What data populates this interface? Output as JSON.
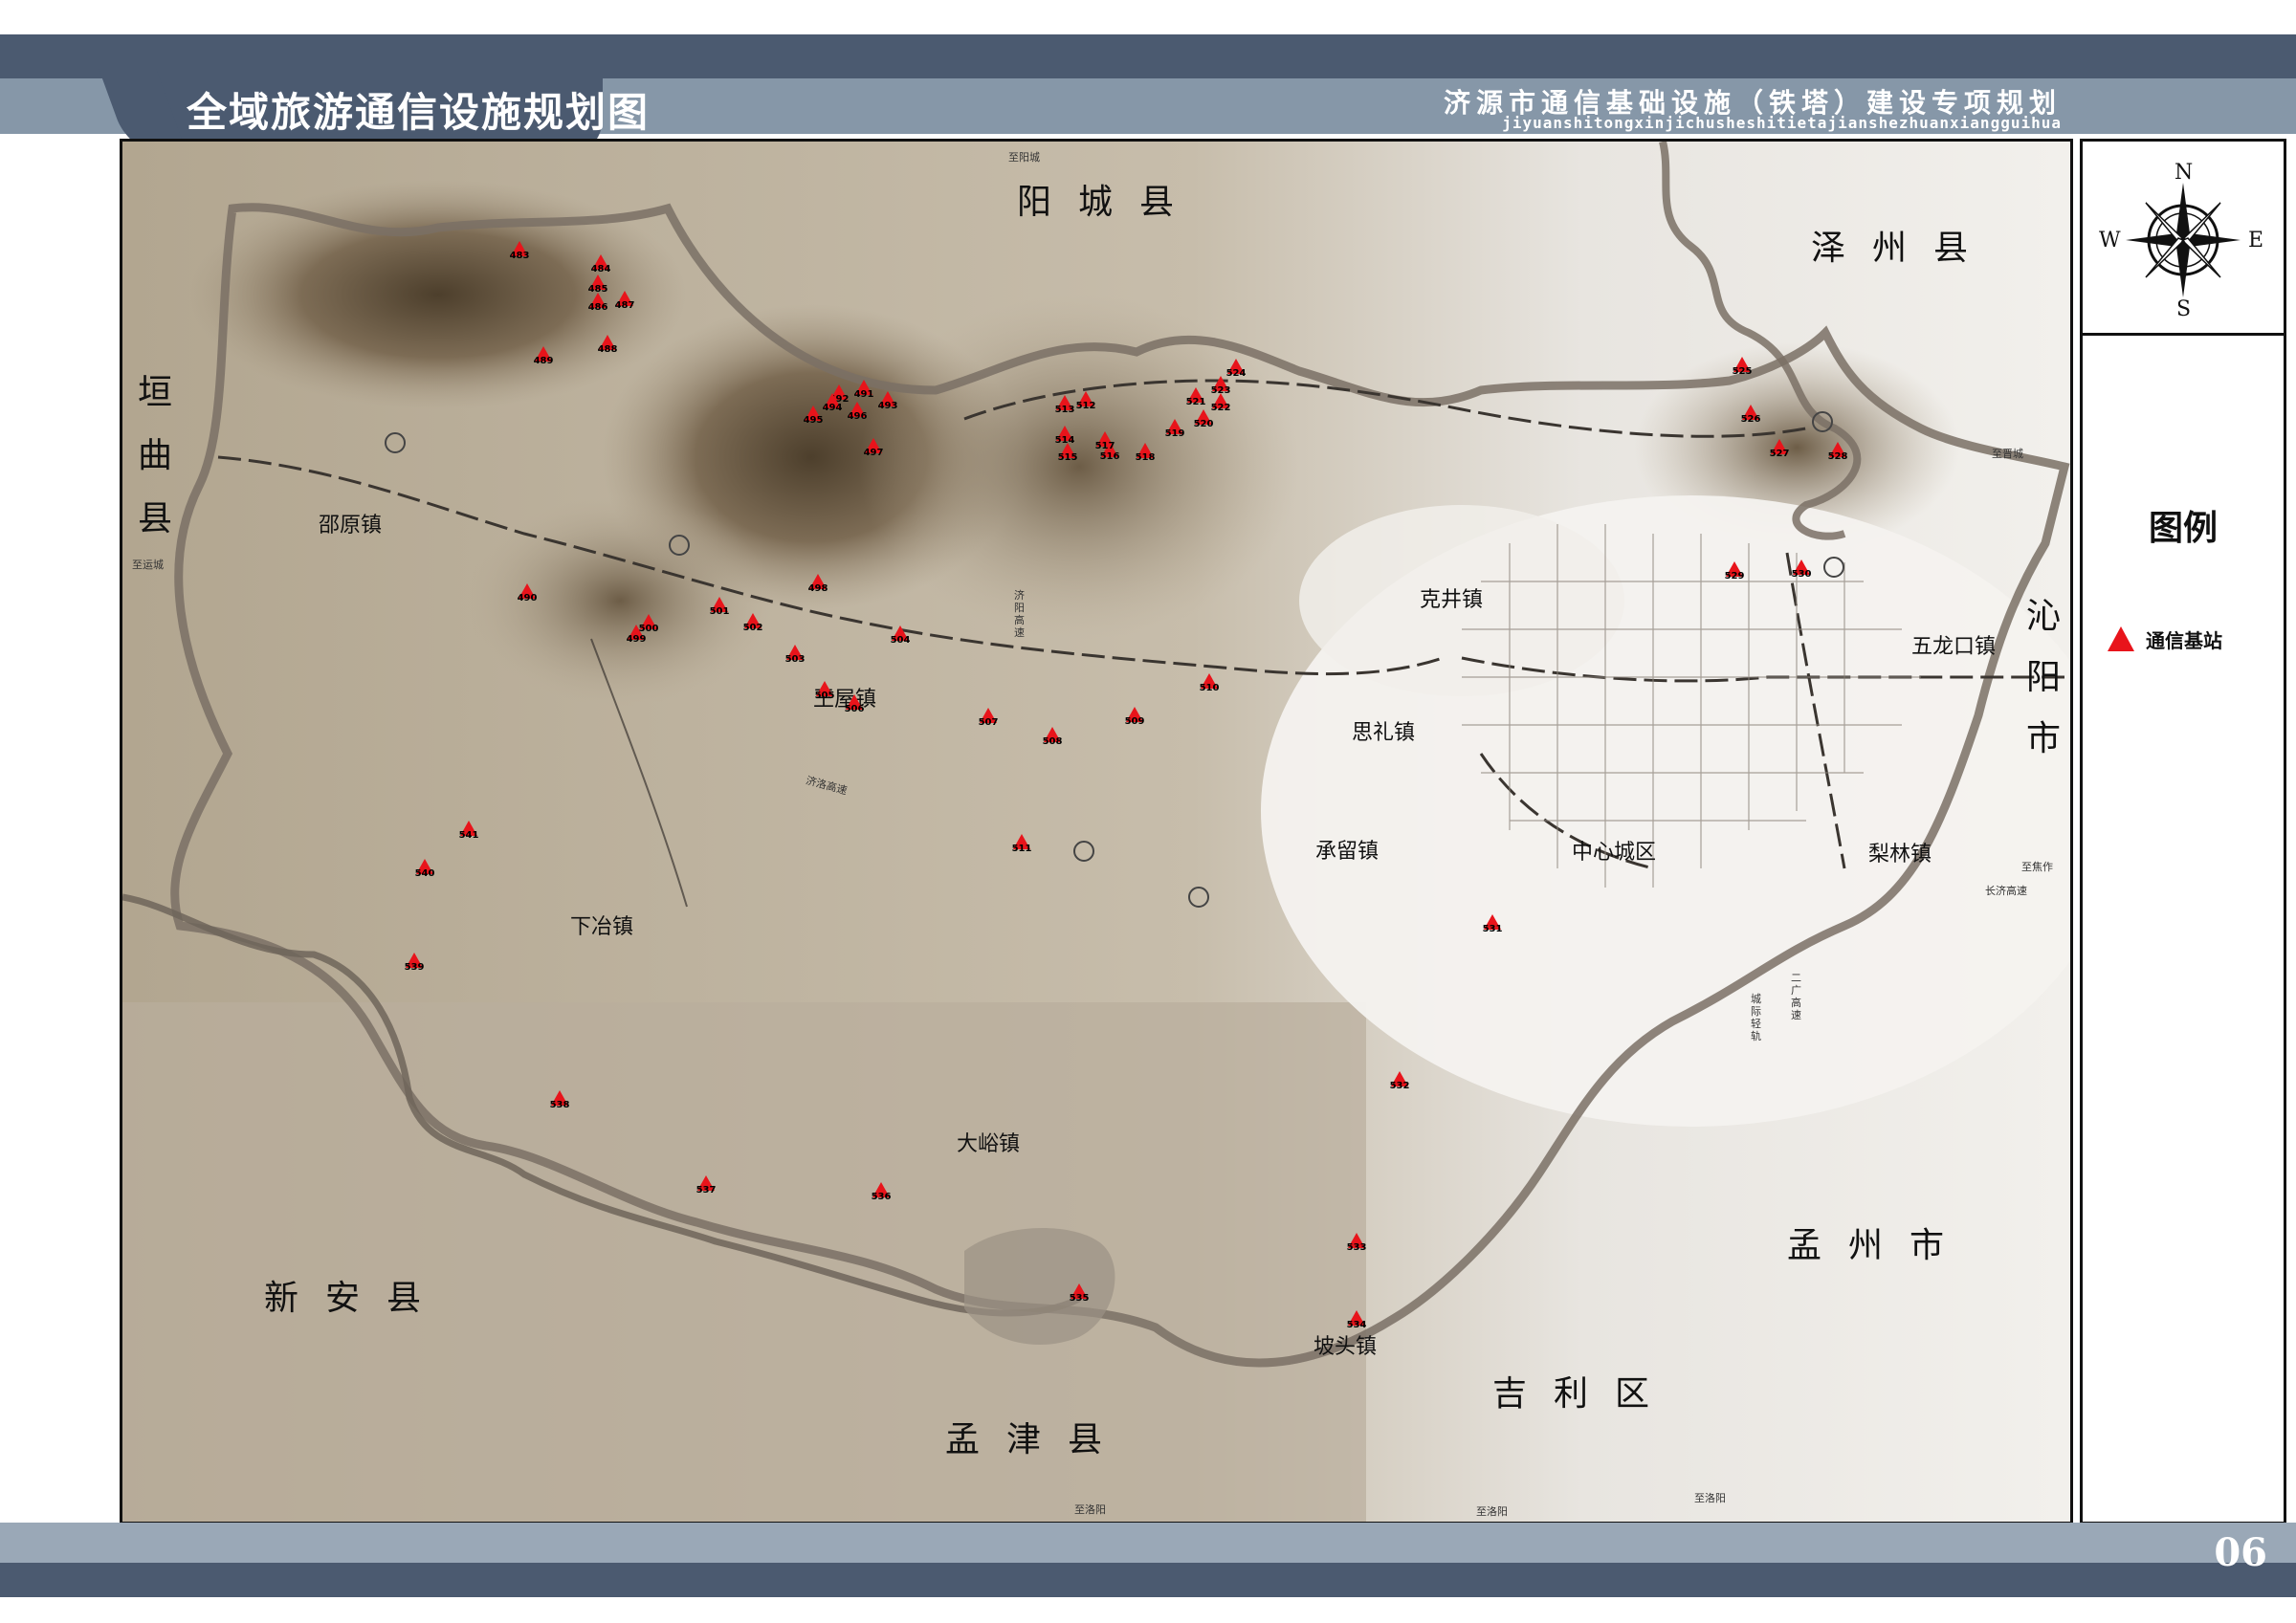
{
  "header": {
    "main_title": "全域旅游通信设施规划图",
    "project_title": "济源市通信基础设施（铁塔）建设专项规划",
    "pinyin": "jiyuanshitongxinjichusheshitietajianshezhuanxiangguihua"
  },
  "footer": {
    "page_number": "06"
  },
  "compass": {
    "n": "N",
    "s": "S",
    "e": "E",
    "w": "W"
  },
  "legend": {
    "title": "图例",
    "items": [
      {
        "label": "通信基站",
        "symbol": "red-triangle",
        "color": "#e8141b"
      }
    ]
  },
  "map": {
    "neighbors": {
      "yangcheng": "阳城县",
      "zezhou": "泽州县",
      "yuanqu": "垣曲县",
      "qinyang": "沁阳市",
      "xinan": "新安县",
      "mengjin": "孟津县",
      "jili": "吉利区",
      "mengzhou": "孟州市"
    },
    "towns": {
      "shaoyuan": "邵原镇",
      "wangwu": "王屋镇",
      "xiaye": "下冶镇",
      "dayu": "大峪镇",
      "potou": "坡头镇",
      "kejing": "克井镇",
      "sili": "思礼镇",
      "chengliu": "承留镇",
      "center": "中心城区",
      "wulongkou": "五龙口镇",
      "lilin": "梨林镇"
    },
    "road_labels": {
      "to_yangcheng": "至阳城",
      "to_yuncheng": "至运城",
      "to_jincheng": "至晋城",
      "to_jiaozuo": "至焦作",
      "changji": "长济高速",
      "jiyang": "济阳高速",
      "jiluo": "济洛高速",
      "to_luoyang_1": "至洛阳",
      "to_luoyang_2": "至洛阳",
      "to_luoyang_3": "至洛阳",
      "erguang": "二广高速",
      "intercity": "城际轻轨"
    },
    "stations": [
      "483",
      "484",
      "485",
      "486",
      "487",
      "488",
      "489",
      "490",
      "491",
      "492",
      "493",
      "494",
      "495",
      "496",
      "497",
      "498",
      "499",
      "500",
      "501",
      "502",
      "503",
      "504",
      "505",
      "506",
      "507",
      "508",
      "509",
      "510",
      "511",
      "512",
      "513",
      "514",
      "515",
      "516",
      "517",
      "518",
      "519",
      "520",
      "521",
      "522",
      "523",
      "524",
      "525",
      "526",
      "527",
      "528",
      "529",
      "530",
      "531",
      "532",
      "533",
      "534",
      "535",
      "536",
      "537",
      "538",
      "539",
      "540",
      "541"
    ]
  }
}
